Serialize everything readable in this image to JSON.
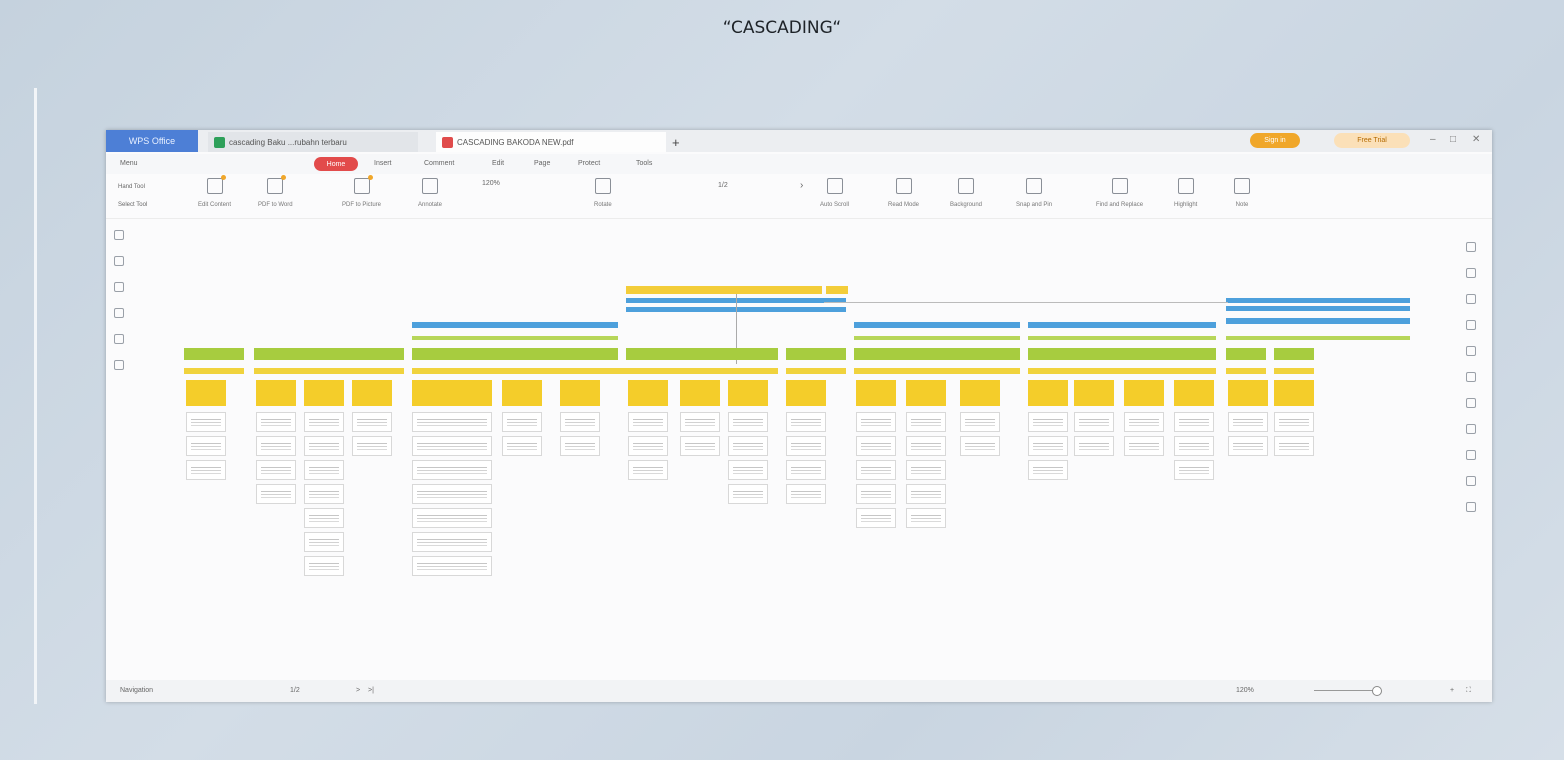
{
  "page": {
    "title": "“CASCADING“"
  },
  "app": {
    "brand": "WPS Office",
    "tabs": [
      {
        "label": "cascading Baku ...rubahn terbaru",
        "type": "sheet"
      },
      {
        "label": "CASCADING BAKODA NEW.pdf",
        "type": "pdf"
      }
    ],
    "new_tab_icon": "plus-icon",
    "sign_in": "Sign in",
    "free_trial": "Free Trial"
  },
  "menu": {
    "items": [
      "Menu",
      "Home",
      "Insert",
      "Comment",
      "Edit",
      "Page",
      "Protect",
      "Tools"
    ],
    "active": "Home"
  },
  "toolbar": {
    "hand_tool": "Hand Tool",
    "select_tool": "Select Tool",
    "items": [
      "Edit Content",
      "PDF to Word",
      "PDF to Picture",
      "Annotate",
      "Rotate",
      "Auto Scroll",
      "Read Mode",
      "Background",
      "Snap and Pin",
      "Find and Replace",
      "Highlight",
      "Note"
    ],
    "zoom": "120%",
    "page": "1/2"
  },
  "status": {
    "navigation": "Navigation",
    "page": "1/2",
    "zoom": "120%"
  },
  "colors": {
    "blue": "#4da0dc",
    "yellow": "#f3cd3a",
    "green": "#a7cc3f",
    "home_pill": "#e24b4b",
    "brand": "#4d7fd6"
  }
}
